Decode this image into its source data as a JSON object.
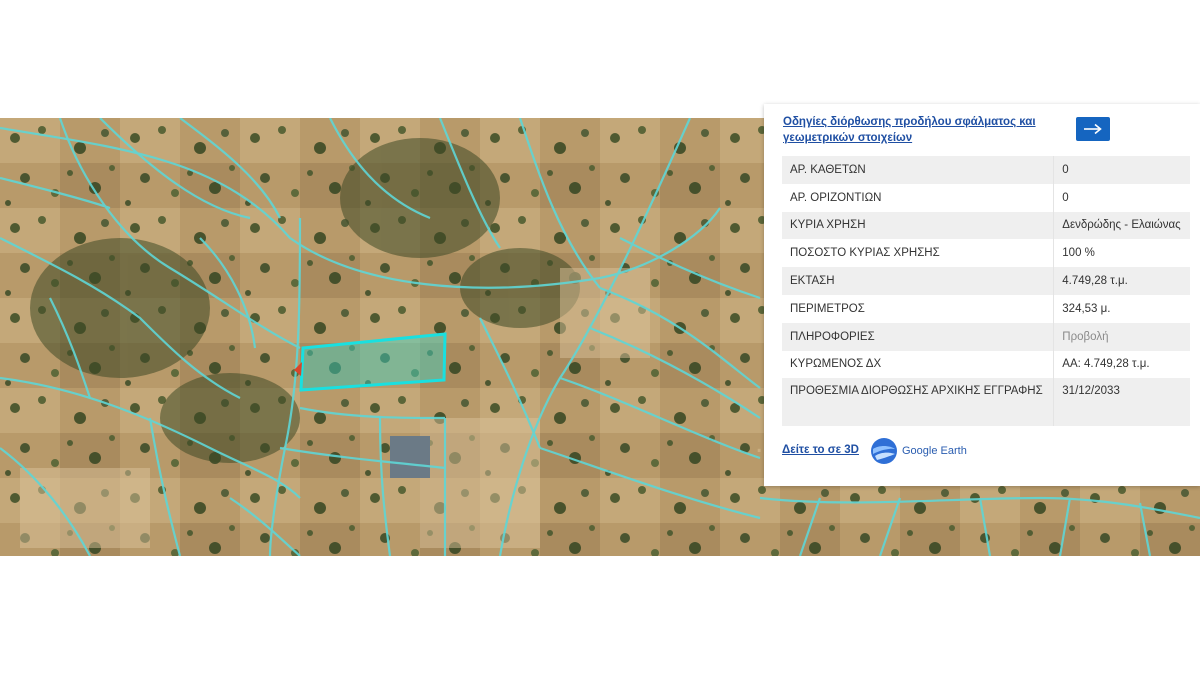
{
  "panel": {
    "guide_link": "Οδηγίες διόρθωσης προδήλου σφάλματος και γεωμετρικών στοιχείων",
    "arrow_icon": "arrow-right-icon",
    "rows": [
      {
        "label": "ΑΡ. ΚΑΘΕΤΩΝ",
        "value": "0"
      },
      {
        "label": "ΑΡ. ΟΡΙΖΟΝΤΙΩΝ",
        "value": "0"
      },
      {
        "label": "ΚΥΡΙΑ ΧΡΗΣΗ",
        "value": "Δενδρώδης - Ελαιώνας"
      },
      {
        "label": "ΠΟΣΟΣΤΟ ΚΥΡΙΑΣ ΧΡΗΣΗΣ",
        "value": "100 %"
      },
      {
        "label": "ΕΚΤΑΣΗ",
        "value": "4.749,28 τ.μ."
      },
      {
        "label": "ΠΕΡΙΜΕΤΡΟΣ",
        "value": "324,53 μ."
      },
      {
        "label": "ΠΛΗΡΟΦΟΡΙΕΣ",
        "value": "Προβολή"
      },
      {
        "label": "ΚΥΡΩΜΕΝΟΣ ΔΧ",
        "value": "ΑΑ: 4.749,28 τ.μ."
      },
      {
        "label": "ΠΡΟΘΕΣΜΙΑ ΔΙΟΡΘΩΣΗΣ ΑΡΧΙΚΗΣ ΕΓΓΡΑΦΗΣ",
        "value": "31/12/2033"
      }
    ],
    "see_3d": "Δείτε το σε 3D",
    "google_earth": "Google Earth"
  },
  "map": {
    "parcel_outline_color": "#5fd6d6",
    "selected_parcel_color": "#19e0e0",
    "marker_color": "#d9442b"
  }
}
